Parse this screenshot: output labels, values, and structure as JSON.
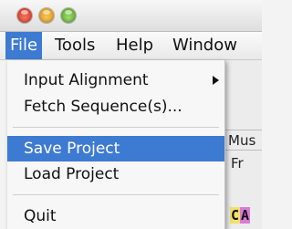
{
  "window": {
    "controls": [
      {
        "name": "close",
        "color": "#e0473a"
      },
      {
        "name": "minimize",
        "color": "#f0b33a"
      },
      {
        "name": "zoom",
        "color": "#72c04a"
      }
    ]
  },
  "menubar": {
    "items": [
      {
        "label": "File",
        "active": true
      },
      {
        "label": "Tools",
        "active": false
      },
      {
        "label": "Help",
        "active": false
      },
      {
        "label": "Window",
        "active": false
      }
    ]
  },
  "file_menu": {
    "items": [
      {
        "label": "Input Alignment",
        "has_submenu": true,
        "selected": false
      },
      {
        "label": "Fetch Sequence(s)...",
        "has_submenu": false,
        "selected": false
      },
      {
        "label": "Save Project",
        "has_submenu": false,
        "selected": true
      },
      {
        "label": "Load Project",
        "has_submenu": false,
        "selected": false
      },
      {
        "label": "Quit",
        "has_submenu": false,
        "selected": false
      }
    ]
  },
  "background_window": {
    "partial_texts": [
      "Mus",
      "Fr"
    ],
    "sequence_fragment": [
      "C",
      "A"
    ]
  },
  "colors": {
    "accent": "#3d7ad2",
    "menu_bg": "#f7f7f7",
    "sequence_c": "#f2e06a",
    "sequence_a": "#d97ad6"
  }
}
